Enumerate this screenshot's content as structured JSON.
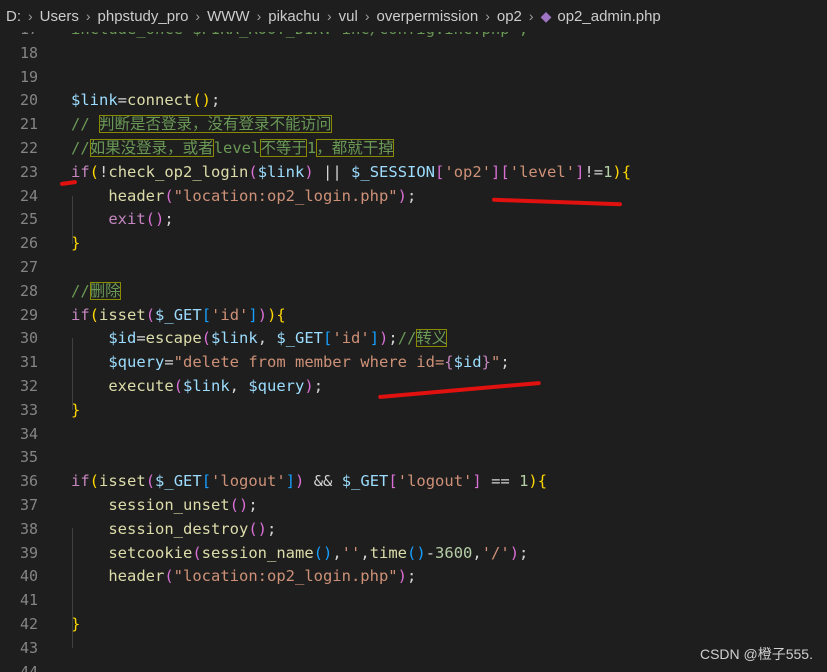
{
  "breadcrumb": [
    "D:",
    "Users",
    "phpstudy_pro",
    "WWW",
    "pikachu",
    "vul",
    "overpermission",
    "op2",
    "op2_admin.php"
  ],
  "lines": [
    {
      "n": "17",
      "s": [
        {
          "t": "include_once $PIKA_ROOT_DIR.'inc/config.inc.php';",
          "c": "c"
        }
      ]
    },
    {
      "n": "18",
      "s": []
    },
    {
      "n": "19",
      "s": []
    },
    {
      "n": "20",
      "s": [
        {
          "t": "$link",
          "c": "v"
        },
        {
          "t": "="
        },
        {
          "t": "connect",
          "c": "f"
        },
        {
          "t": "()",
          "c": "b1"
        },
        {
          "t": ";"
        }
      ]
    },
    {
      "n": "21",
      "s": [
        {
          "t": "// ",
          "c": "c"
        },
        {
          "t": "判断是否登录，没有登录不能访问",
          "c": "c",
          "h": 1
        }
      ]
    },
    {
      "n": "22",
      "s": [
        {
          "t": "//",
          "c": "c"
        },
        {
          "t": "如果没登录，或者",
          "c": "c",
          "h": 1
        },
        {
          "t": "level",
          "c": "c"
        },
        {
          "t": "不等于",
          "c": "c",
          "h": 1
        },
        {
          "t": "1",
          "c": "c"
        },
        {
          "t": "，都就干掉",
          "c": "c",
          "h": 1
        }
      ]
    },
    {
      "n": "23",
      "s": [
        {
          "t": "if",
          "c": "k"
        },
        {
          "t": "(",
          "c": "b1"
        },
        {
          "t": "!"
        },
        {
          "t": "check_op2_login",
          "c": "f"
        },
        {
          "t": "(",
          "c": "b2"
        },
        {
          "t": "$link",
          "c": "v"
        },
        {
          "t": ")",
          "c": "b2"
        },
        {
          "t": " || "
        },
        {
          "t": "$_SESSION",
          "c": "v"
        },
        {
          "t": "[",
          "c": "b2"
        },
        {
          "t": "'op2'",
          "c": "s"
        },
        {
          "t": "]",
          "c": "b2"
        },
        {
          "t": "[",
          "c": "b2"
        },
        {
          "t": "'level'",
          "c": "s"
        },
        {
          "t": "]",
          "c": "b2"
        },
        {
          "t": "!="
        },
        {
          "t": "1",
          "c": "n"
        },
        {
          "t": ")",
          "c": "b1"
        },
        {
          "t": "{",
          "c": "b1"
        }
      ]
    },
    {
      "n": "24",
      "s": [
        {
          "t": "    "
        },
        {
          "t": "header",
          "c": "f"
        },
        {
          "t": "(",
          "c": "b2"
        },
        {
          "t": "\"location:op2_login.php\"",
          "c": "s"
        },
        {
          "t": ")",
          "c": "b2"
        },
        {
          "t": ";"
        }
      ]
    },
    {
      "n": "25",
      "s": [
        {
          "t": "    "
        },
        {
          "t": "exit",
          "c": "k"
        },
        {
          "t": "()",
          "c": "b2"
        },
        {
          "t": ";"
        }
      ]
    },
    {
      "n": "26",
      "s": [
        {
          "t": "}",
          "c": "b1"
        }
      ]
    },
    {
      "n": "27",
      "s": []
    },
    {
      "n": "28",
      "s": [
        {
          "t": "//",
          "c": "c"
        },
        {
          "t": "删除",
          "c": "c",
          "h": 1
        }
      ]
    },
    {
      "n": "29",
      "s": [
        {
          "t": "if",
          "c": "k"
        },
        {
          "t": "(",
          "c": "b1"
        },
        {
          "t": "isset",
          "c": "f"
        },
        {
          "t": "(",
          "c": "b2"
        },
        {
          "t": "$_GET",
          "c": "v"
        },
        {
          "t": "[",
          "c": "b3"
        },
        {
          "t": "'id'",
          "c": "s"
        },
        {
          "t": "]",
          "c": "b3"
        },
        {
          "t": ")",
          "c": "b2"
        },
        {
          "t": ")",
          "c": "b1"
        },
        {
          "t": "{",
          "c": "b1"
        }
      ]
    },
    {
      "n": "30",
      "s": [
        {
          "t": "    "
        },
        {
          "t": "$id",
          "c": "v"
        },
        {
          "t": "="
        },
        {
          "t": "escape",
          "c": "f"
        },
        {
          "t": "(",
          "c": "b2"
        },
        {
          "t": "$link",
          "c": "v"
        },
        {
          "t": ", "
        },
        {
          "t": "$_GET",
          "c": "v"
        },
        {
          "t": "[",
          "c": "b3"
        },
        {
          "t": "'id'",
          "c": "s"
        },
        {
          "t": "]",
          "c": "b3"
        },
        {
          "t": ")",
          "c": "b2"
        },
        {
          "t": ";"
        },
        {
          "t": "//",
          "c": "c"
        },
        {
          "t": "转义",
          "c": "c",
          "h": 1
        }
      ]
    },
    {
      "n": "31",
      "s": [
        {
          "t": "    "
        },
        {
          "t": "$query",
          "c": "v"
        },
        {
          "t": "="
        },
        {
          "t": "\"delete from member where id=",
          "c": "s"
        },
        {
          "t": "{",
          "c": "k"
        },
        {
          "t": "$id",
          "c": "v"
        },
        {
          "t": "}",
          "c": "k"
        },
        {
          "t": "\"",
          "c": "s"
        },
        {
          "t": ";"
        }
      ]
    },
    {
      "n": "32",
      "s": [
        {
          "t": "    "
        },
        {
          "t": "execute",
          "c": "f"
        },
        {
          "t": "(",
          "c": "b2"
        },
        {
          "t": "$link",
          "c": "v"
        },
        {
          "t": ", "
        },
        {
          "t": "$query",
          "c": "v"
        },
        {
          "t": ")",
          "c": "b2"
        },
        {
          "t": ";"
        }
      ]
    },
    {
      "n": "33",
      "s": [
        {
          "t": "}",
          "c": "b1"
        }
      ]
    },
    {
      "n": "34",
      "s": []
    },
    {
      "n": "35",
      "s": []
    },
    {
      "n": "36",
      "s": [
        {
          "t": "if",
          "c": "k"
        },
        {
          "t": "(",
          "c": "b1"
        },
        {
          "t": "isset",
          "c": "f"
        },
        {
          "t": "(",
          "c": "b2"
        },
        {
          "t": "$_GET",
          "c": "v"
        },
        {
          "t": "[",
          "c": "b3"
        },
        {
          "t": "'logout'",
          "c": "s"
        },
        {
          "t": "]",
          "c": "b3"
        },
        {
          "t": ")",
          "c": "b2"
        },
        {
          "t": " && "
        },
        {
          "t": "$_GET",
          "c": "v"
        },
        {
          "t": "[",
          "c": "b2"
        },
        {
          "t": "'logout'",
          "c": "s"
        },
        {
          "t": "]",
          "c": "b2"
        },
        {
          "t": " == "
        },
        {
          "t": "1",
          "c": "n"
        },
        {
          "t": ")",
          "c": "b1"
        },
        {
          "t": "{",
          "c": "b1"
        }
      ]
    },
    {
      "n": "37",
      "s": [
        {
          "t": "    "
        },
        {
          "t": "session_unset",
          "c": "f"
        },
        {
          "t": "()",
          "c": "b2"
        },
        {
          "t": ";"
        }
      ]
    },
    {
      "n": "38",
      "s": [
        {
          "t": "    "
        },
        {
          "t": "session_destroy",
          "c": "f"
        },
        {
          "t": "()",
          "c": "b2"
        },
        {
          "t": ";"
        }
      ]
    },
    {
      "n": "39",
      "s": [
        {
          "t": "    "
        },
        {
          "t": "setcookie",
          "c": "f"
        },
        {
          "t": "(",
          "c": "b2"
        },
        {
          "t": "session_name",
          "c": "f"
        },
        {
          "t": "()",
          "c": "b3"
        },
        {
          "t": ","
        },
        {
          "t": "''",
          "c": "s"
        },
        {
          "t": ","
        },
        {
          "t": "time",
          "c": "f"
        },
        {
          "t": "()",
          "c": "b3"
        },
        {
          "t": "-"
        },
        {
          "t": "3600",
          "c": "n"
        },
        {
          "t": ","
        },
        {
          "t": "'/'",
          "c": "s"
        },
        {
          "t": ")",
          "c": "b2"
        },
        {
          "t": ";"
        }
      ]
    },
    {
      "n": "40",
      "s": [
        {
          "t": "    "
        },
        {
          "t": "header",
          "c": "f"
        },
        {
          "t": "(",
          "c": "b2"
        },
        {
          "t": "\"location:op2_login.php\"",
          "c": "s"
        },
        {
          "t": ")",
          "c": "b2"
        },
        {
          "t": ";"
        }
      ]
    },
    {
      "n": "41",
      "s": []
    },
    {
      "n": "42",
      "s": [
        {
          "t": "}",
          "c": "b1"
        }
      ]
    },
    {
      "n": "43",
      "s": []
    },
    {
      "n": "44",
      "s": []
    }
  ],
  "watermark": "CSDN @橙子555."
}
